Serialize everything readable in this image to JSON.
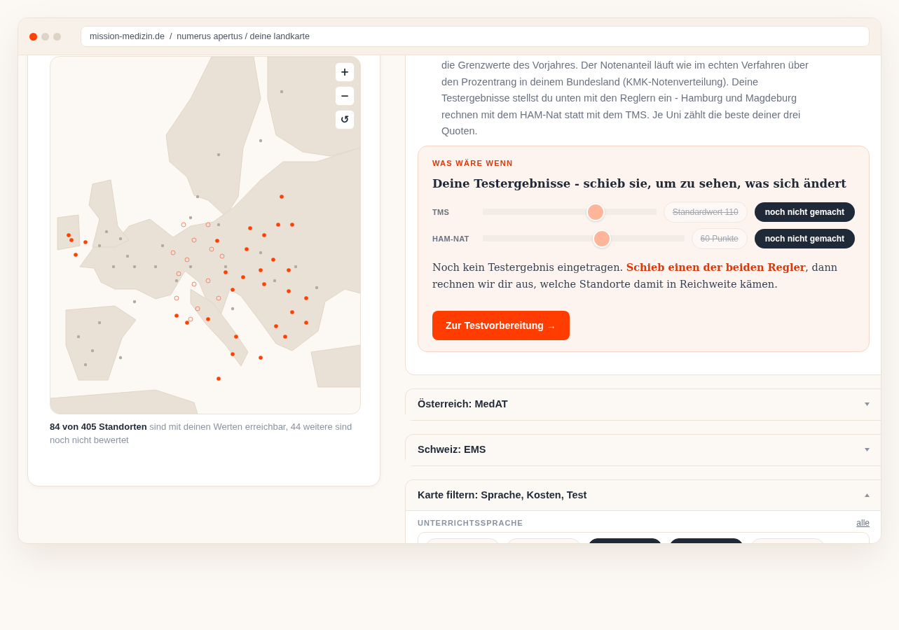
{
  "browser": {
    "url": "mission-medizin.de  /  numerus apertus / deine landkarte"
  },
  "map": {
    "controls": [
      "+",
      "−",
      "↺"
    ],
    "caption": "**84 von 405 Standorten** sind mit deinen Werten erreichbar, 44 weitere sind noch nicht bewertet"
  },
  "intro": "die Grenzwerte des Vorjahres. Der Notenanteil läuft wie im echten Verfahren über den Prozentrang in deinem Bundesland (KMK-Notenverteilung). Deine Testergebnisse stellst du unten mit den Reglern ein - Hamburg und Magdeburg rechnen mit dem HAM-Nat statt mit dem TMS. Je Uni zählt die beste deiner drei Quoten.",
  "what_if": {
    "eyebrow": "WAS WÄRE WENN",
    "title": "Deine Testergebnisse - schieb sie, um zu sehen, was sich ändert",
    "sliders": [
      {
        "label": "TMS",
        "level": 0.65,
        "value": "Standardwert 110",
        "status": "noch nicht gemacht"
      },
      {
        "label": "HAM-NAT",
        "level": 0.59,
        "value": "60 Punkte",
        "status": "noch nicht gemacht"
      }
    ],
    "note": "Noch kein Testergebnis eingetragen. **Schieb einen der beiden Regler**, dann rechnen wir dir aus, welche Standorte damit in Reichweite kämen.",
    "button": "Zur Testvorbereitung →"
  },
  "accordions": [
    {
      "title": "Österreich: MedAT",
      "expanded": false
    },
    {
      "title": "Schweiz: EMS",
      "expanded": false
    },
    {
      "title": "Karte filtern: Sprache, Kosten, Test",
      "expanded": true
    }
  ],
  "filter": {
    "label": "UNTERRICHTSSPRACHE",
    "link": "alle",
    "chips": [
      {
        "selected": false
      },
      {
        "selected": false
      },
      {
        "selected": true
      },
      {
        "selected": true
      },
      {
        "selected": false
      }
    ]
  }
}
